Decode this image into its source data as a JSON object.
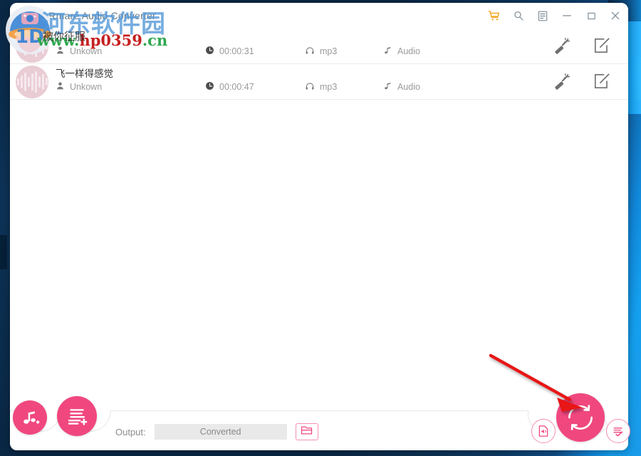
{
  "window": {
    "title": "DRmare Audio Converter",
    "controls": [
      {
        "name": "cart-icon",
        "label": "Cart",
        "color": "#f5a623"
      },
      {
        "name": "search-icon",
        "label": "Search",
        "color": "#7d8a94"
      },
      {
        "name": "menu-icon",
        "label": "Menu",
        "color": "#7d8a94"
      },
      {
        "name": "minimize-icon",
        "label": "Minimize",
        "color": "#7d8a94"
      },
      {
        "name": "maximize-icon",
        "label": "Maximize",
        "color": "#7d8a94"
      },
      {
        "name": "close-icon",
        "label": "Close",
        "color": "#7d8a94"
      }
    ]
  },
  "file_list": {
    "rows": [
      {
        "title": "",
        "artist": "Unkown",
        "duration": "00:00:31",
        "format": "mp3",
        "type": "Audio",
        "edit_label": "Edit",
        "effect_label": "Effects"
      },
      {
        "title": "飞一样得感觉",
        "artist": "Unkown",
        "duration": "00:00:47",
        "format": "mp3",
        "type": "Audio",
        "edit_label": "Edit",
        "effect_label": "Effects"
      }
    ]
  },
  "bottom_bar": {
    "add_file_label": "Add Files",
    "add_list_label": "Add Playlist",
    "output_label": "Output:",
    "output_path": "Converted",
    "browse_label": "Browse",
    "merge_label": "Merge into one file",
    "convert_label": "Convert",
    "history_label": "Converted History"
  },
  "watermark": {
    "logo_label": "site-logo",
    "chinese_big": "河东软件园",
    "url_prefix": "www.",
    "url_main": "hp0359",
    "url_suffix": ".cn",
    "chinese_small": "被你征服"
  },
  "annotation": {
    "arrow_label": "red-pointer-arrow",
    "arrow_color": "#e81919",
    "points_to": "convert-button"
  },
  "theme": {
    "accent_pink": "#f0477f",
    "accent_pink_light": "#f48fb3",
    "desktop_blue": "#0a2744",
    "desktop_blue_bright": "#14a0ef",
    "text_gray": "#9a9a9a",
    "title_gray": "#6b7b86"
  }
}
